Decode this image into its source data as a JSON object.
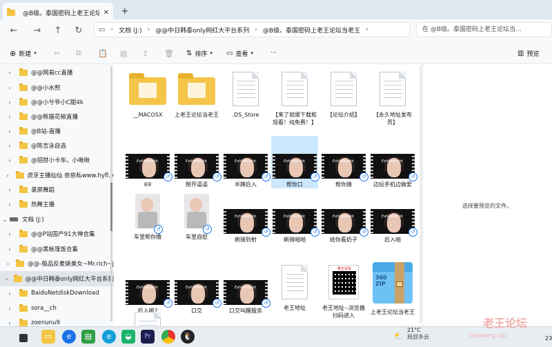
{
  "window": {
    "tab_title": "@B级。泰国密码上老王论坛当",
    "new_tab": "+"
  },
  "nav": {
    "breadcrumb": [
      "文档 (J:)",
      "@@中日韩泰only网红大平台系列",
      "@B级。泰国密码上老王论坛当老王"
    ],
    "search_placeholder": "在 @B级。泰国密码上老王论坛当..."
  },
  "toolbar": {
    "new_label": "新建",
    "sort_label": "排序",
    "view_label": "查看",
    "more_label": "···",
    "preview_label": "预览"
  },
  "sidebar": {
    "items": [
      {
        "label": "@@网易cc直播",
        "type": "folder"
      },
      {
        "label": "@@小水熙",
        "type": "folder"
      },
      {
        "label": "@@小兮爷小C甜4k",
        "type": "folder"
      },
      {
        "label": "@@熊猫花椒直播",
        "type": "folder"
      },
      {
        "label": "@B站-直播",
        "type": "folder"
      },
      {
        "label": "@陈言泳自选",
        "type": "folder"
      },
      {
        "label": "@招财小卡车。小啾啾",
        "type": "folder"
      },
      {
        "label": "虎牙主播仙仙 依依私www.hyfl.v",
        "type": "folder"
      },
      {
        "label": "录屏舞蹈",
        "type": "folder"
      },
      {
        "label": "热舞主播",
        "type": "folder"
      },
      {
        "label": "文档 (J:)",
        "type": "drive"
      },
      {
        "label": "@@P站国产91大神合集",
        "type": "folder"
      },
      {
        "label": "@@黑帐篷饭合集",
        "type": "folder"
      },
      {
        "label": "@@-极品反差婊美女~Mr.rich~j",
        "type": "folder"
      },
      {
        "label": "@@中日韩泰only网红大平台系列",
        "type": "folder"
      },
      {
        "label": "BaiduNetdiskDownload",
        "type": "folder"
      },
      {
        "label": "sora__ch",
        "type": "folder"
      },
      {
        "label": "zoenunu9",
        "type": "folder"
      }
    ]
  },
  "files": [
    {
      "name": "__MACOSX",
      "kind": "folder"
    },
    {
      "name": "上老王论坛当老王",
      "kind": "folder"
    },
    {
      "name": ".DS_Store",
      "kind": "doc"
    },
    {
      "name": "【来了就顺下载和观看！纯免费！】",
      "kind": "doc"
    },
    {
      "name": "【论坛介绍】",
      "kind": "doc"
    },
    {
      "name": "【永久地址发布页】",
      "kind": "doc"
    },
    {
      "name": "69",
      "kind": "video"
    },
    {
      "name": "掰开逼逼",
      "kind": "video"
    },
    {
      "name": "半蹲后入",
      "kind": "video"
    },
    {
      "name": "帮你口",
      "kind": "video"
    },
    {
      "name": "帮你撸",
      "kind": "video"
    },
    {
      "name": "边玩手机边做爱",
      "kind": "video"
    },
    {
      "name": "车里帮你撸",
      "kind": "photo"
    },
    {
      "name": "车里自慰",
      "kind": "photo"
    },
    {
      "name": "痢骑到射",
      "kind": "video"
    },
    {
      "name": "痢骑啪啪",
      "kind": "video"
    },
    {
      "name": "给你看奶子",
      "kind": "video"
    },
    {
      "name": "后入啪",
      "kind": "video"
    },
    {
      "name": "后入啪2",
      "kind": "video"
    },
    {
      "name": "口交",
      "kind": "video"
    },
    {
      "name": "口交叫醒服务",
      "kind": "video"
    },
    {
      "name": "老王地址",
      "kind": "doc"
    },
    {
      "name": "老王地址--浏览器扫码进入",
      "kind": "qr"
    },
    {
      "name": "上老王论坛当老王",
      "kind": "zip"
    },
    {
      "name": "",
      "kind": "doc"
    }
  ],
  "video_watermark": "Exhibitionist",
  "qr_caption": "老王论坛",
  "zip_text": "360\nZIP",
  "preview_text": "选择要预览的文件。",
  "taskbar": {
    "weather_temp": "21°C",
    "weather_desc": "局部多云",
    "clock": "23"
  },
  "watermark": {
    "text": "老王论坛",
    "url": "laowang.vip"
  },
  "colors": {
    "accent": "#1a73e8",
    "folder": "#f5c54a",
    "selection": "#cce8ff"
  }
}
